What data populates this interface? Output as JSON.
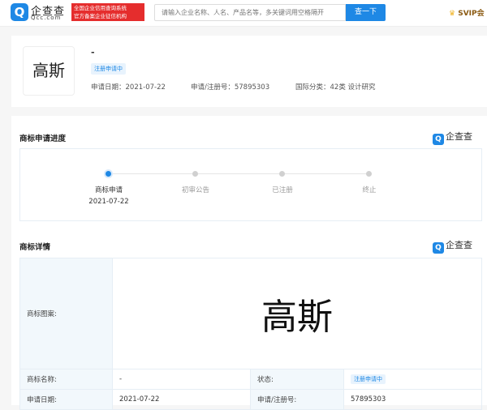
{
  "header": {
    "logo_glyph": "Q",
    "logo_name": "企查查",
    "logo_url": "Qcc.com",
    "badge_line1": "全国企业信用查询系统",
    "badge_line2": "官方备案企业征信机构",
    "search_placeholder": "请输入企业名称、人名、产品名等，多关键词用空格隔开",
    "search_button": "查一下",
    "svip_label": "SVIP会"
  },
  "summary": {
    "thumb_text": "高斯",
    "title": "-",
    "status": "注册申请中",
    "apply_date": "申请日期：2021-07-22",
    "reg_no": "申请/注册号：57895303",
    "intl_class": "国际分类：42类 设计研究"
  },
  "progress": {
    "title": "商标申请进度",
    "brand": "企查查",
    "steps": [
      {
        "label": "商标申请",
        "date": "2021-07-22"
      },
      {
        "label": "初审公告"
      },
      {
        "label": "已注册"
      },
      {
        "label": "终止"
      }
    ]
  },
  "details": {
    "title": "商标详情",
    "brand": "企查查",
    "pattern_label": "商标图案:",
    "pattern_text": "高斯",
    "name_label": "商标名称:",
    "name_value": "-",
    "status_label": "状态:",
    "status_value": "注册申请中",
    "date_label": "申请日期:",
    "date_value": "2021-07-22",
    "regno_label": "申请/注册号:",
    "regno_value": "57895303"
  }
}
